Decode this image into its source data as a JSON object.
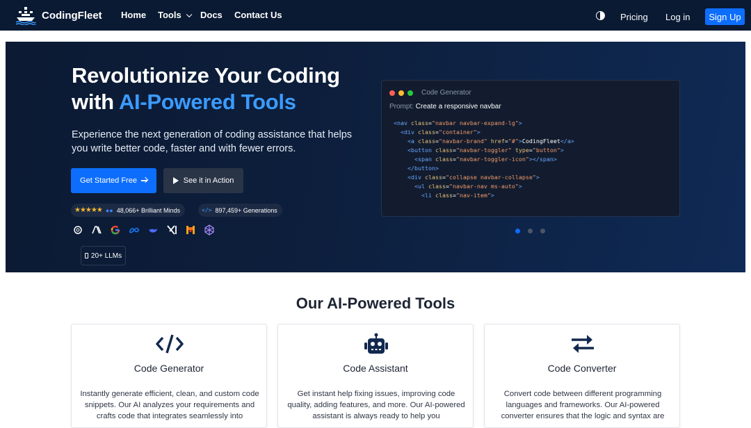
{
  "nav": {
    "brand": "CodingFleet",
    "home": "Home",
    "tools": "Tools",
    "docs": "Docs",
    "contact": "Contact Us",
    "pricing": "Pricing",
    "login": "Log in",
    "signup": "Sign Up"
  },
  "hero": {
    "title_line1": "Revolutionize Your Coding",
    "title_with": "with ",
    "title_accent": "AI-Powered Tools",
    "subtitle": "Experience the next generation of coding assistance that helps you write better code, faster and with fewer errors.",
    "cta_primary": "Get Started Free",
    "cta_secondary": "See it in Action",
    "users_count": "48,066+ Brilliant Minds",
    "generations": "897,459+ Generations",
    "rating_stars": 5,
    "llm_badge": "20+ LLMs",
    "llm_icons": [
      "openai-icon",
      "anthropic-icon",
      "google-icon",
      "meta-icon",
      "deepseek-icon",
      "xai-icon",
      "mistral-icon",
      "perplexity-icon"
    ]
  },
  "code_card": {
    "title": "Code Generator",
    "prompt_label": "Prompt:",
    "prompt_value": "Create a responsive navbar",
    "lines": [
      "<nav class=\"navbar navbar-expand-lg\">",
      "  <div class=\"container\">",
      "    <a class=\"navbar-brand\" href=\"#\">CodingFleet</a>",
      "    <button class=\"navbar-toggler\" type=\"button\">",
      "      <span class=\"navbar-toggler-icon\"></span>",
      "    </button>",
      "    <div class=\"collapse navbar-collapse\">",
      "      <ul class=\"navbar-nav ms-auto\">",
      "        <li class=\"nav-item\">"
    ],
    "slide_count": 3,
    "active_slide": 1
  },
  "tools": {
    "heading": "Our AI-Powered Tools",
    "items": [
      {
        "name": "Code Generator",
        "icon": "code-icon",
        "description": "Instantly generate efficient, clean, and custom code snippets. Our AI analyzes your requirements and crafts code that integrates seamlessly into"
      },
      {
        "name": "Code Assistant",
        "icon": "robot-icon",
        "description": "Get instant help fixing issues, improving code quality, adding features, and more. Our AI-powered assistant is always ready to help you"
      },
      {
        "name": "Code Converter",
        "icon": "exchange-arrows-icon",
        "description": "Convert code between different programming languages and frameworks. Our AI-powered converter ensures that the logic and syntax are"
      }
    ]
  },
  "colors": {
    "navbar": "#0a1a33",
    "primary": "#0d6efd",
    "accent_text": "#3b9bff",
    "star": "#f5b82e",
    "icon_navy": "#12294f"
  }
}
